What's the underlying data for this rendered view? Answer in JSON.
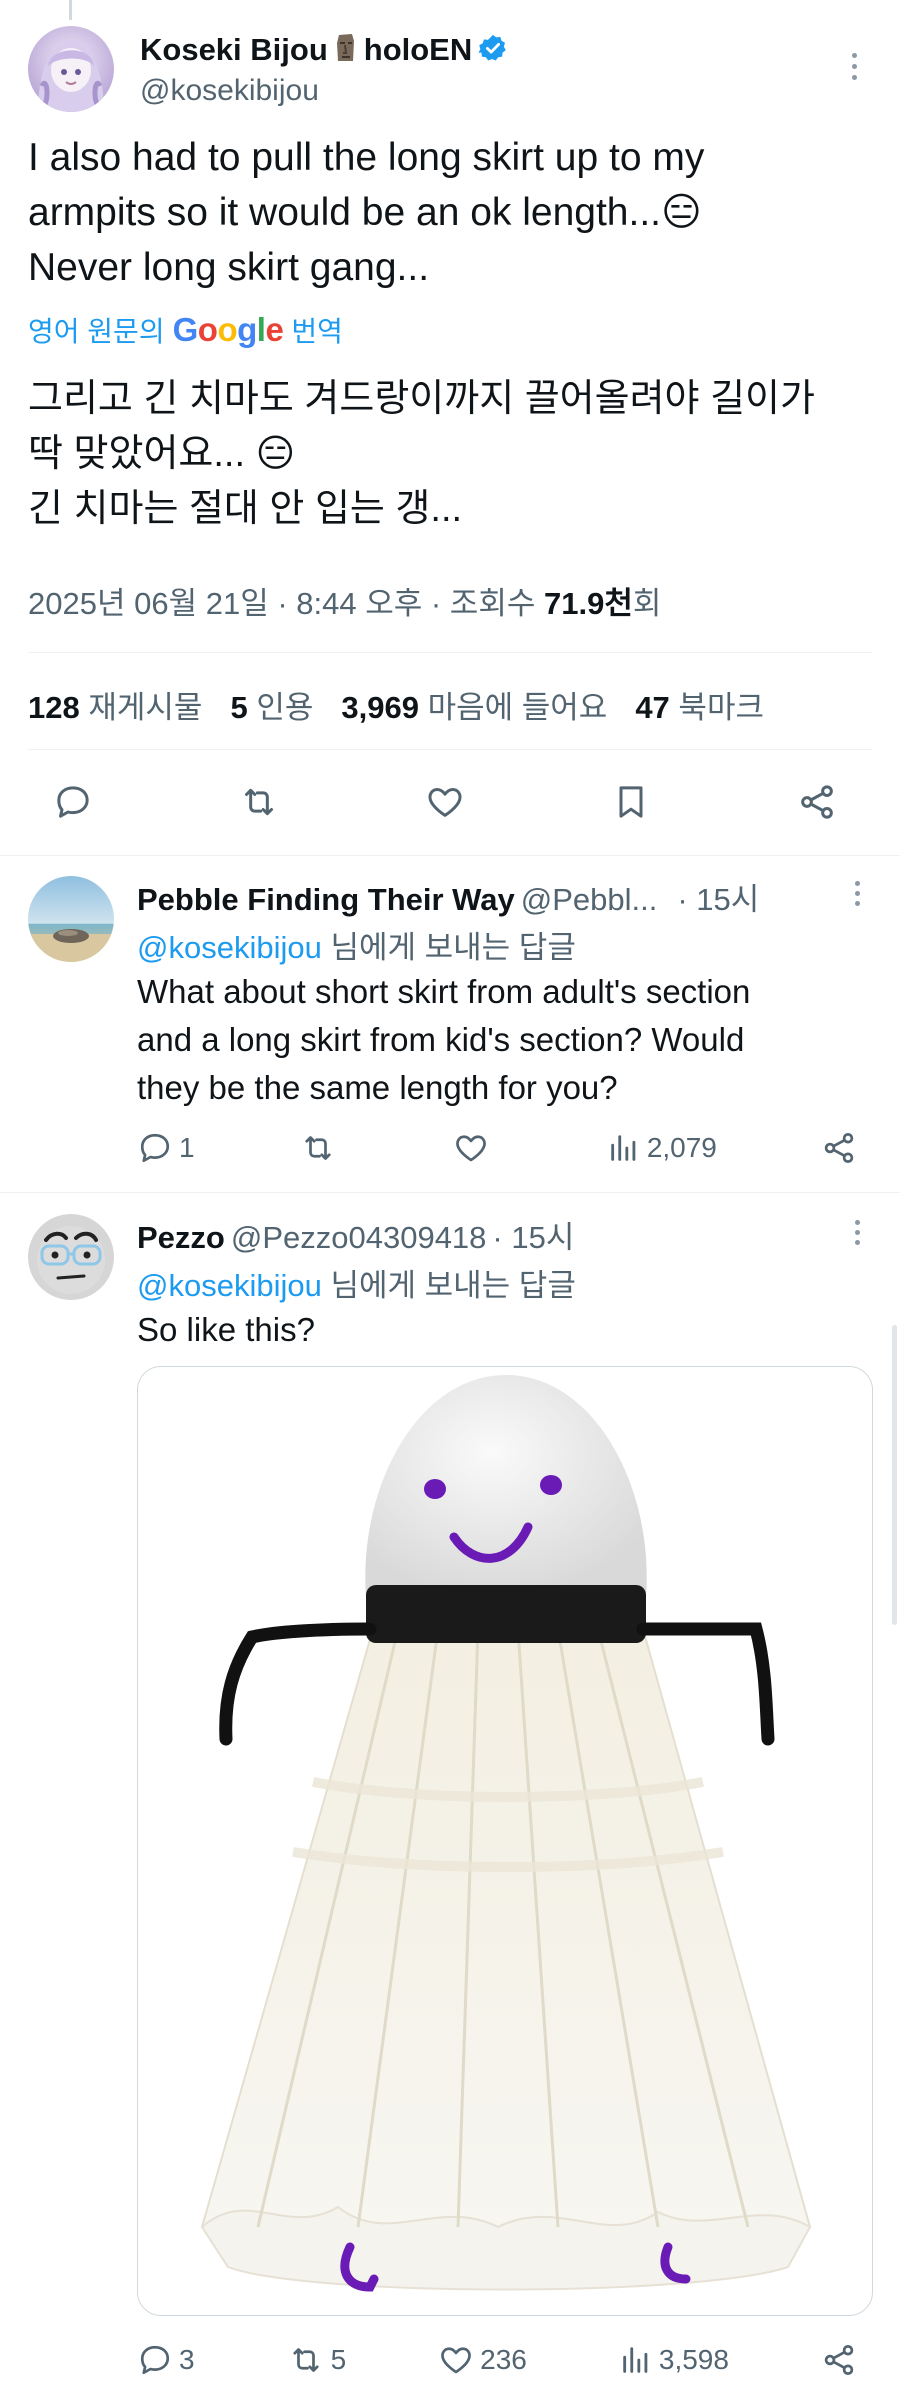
{
  "main_tweet": {
    "display_name": "Koseki Bijou",
    "name_suffix": "holoEN",
    "handle": "@kosekibijou",
    "text_lines": [
      "I also had to pull the long skirt up to my",
      "armpits so it would be an ok length...😑",
      "Never long skirt gang..."
    ],
    "translate_prefix": "영어 원문의",
    "translate_brand": "Google",
    "translate_suffix": "번역",
    "translated_lines": [
      "그리고 긴 치마도 겨드랑이까지 끌어올려야 길이가",
      "딱 맞았어요... 😑",
      "긴 치마는 절대 안 입는 갱..."
    ],
    "meta_date": "2025년 06월 21일 · 8:44 오후 · 조회수 ",
    "meta_views": "71.9천",
    "meta_views_suffix": "회",
    "stats": {
      "reposts_count": "128",
      "reposts_label": "재게시물",
      "quotes_count": "5",
      "quotes_label": "인용",
      "likes_count": "3,969",
      "likes_label": "마음에 들어요",
      "bookmarks_count": "47",
      "bookmarks_label": "북마크"
    }
  },
  "replies": [
    {
      "display_name": "Pebble Finding Their Way",
      "handle": "@Pebbl...",
      "time": "· 15시",
      "reply_to_mention": "@kosekibijou",
      "reply_to_suffix": " 님에게 보내는 답글",
      "body_lines": [
        "What about short skirt from adult's section",
        "and a long skirt from kid's section? Would",
        "they be the same length for you?"
      ],
      "replies_count": "1",
      "reposts_count": "",
      "likes_count": "",
      "views_count": "2,079"
    },
    {
      "display_name": "Pezzo",
      "handle": "@Pezzo04309418",
      "time": "· 15시",
      "reply_to_mention": "@kosekibijou",
      "reply_to_suffix": " 님에게 보내는 답글",
      "body_lines": [
        "So like this?"
      ],
      "replies_count": "3",
      "reposts_count": "5",
      "likes_count": "236",
      "views_count": "3,598"
    }
  ],
  "colors": {
    "accent": "#1d9bf0",
    "text_primary": "#0f1419",
    "text_secondary": "#536471",
    "divider": "#eff3f4",
    "verified": "#1d9bf0"
  },
  "icons": {
    "verified": "verified-badge-icon",
    "reply": "reply-icon",
    "repost": "repost-icon",
    "like": "heart-icon",
    "bookmark": "bookmark-icon",
    "share": "share-icon",
    "views": "views-icon",
    "more": "more-icon"
  }
}
